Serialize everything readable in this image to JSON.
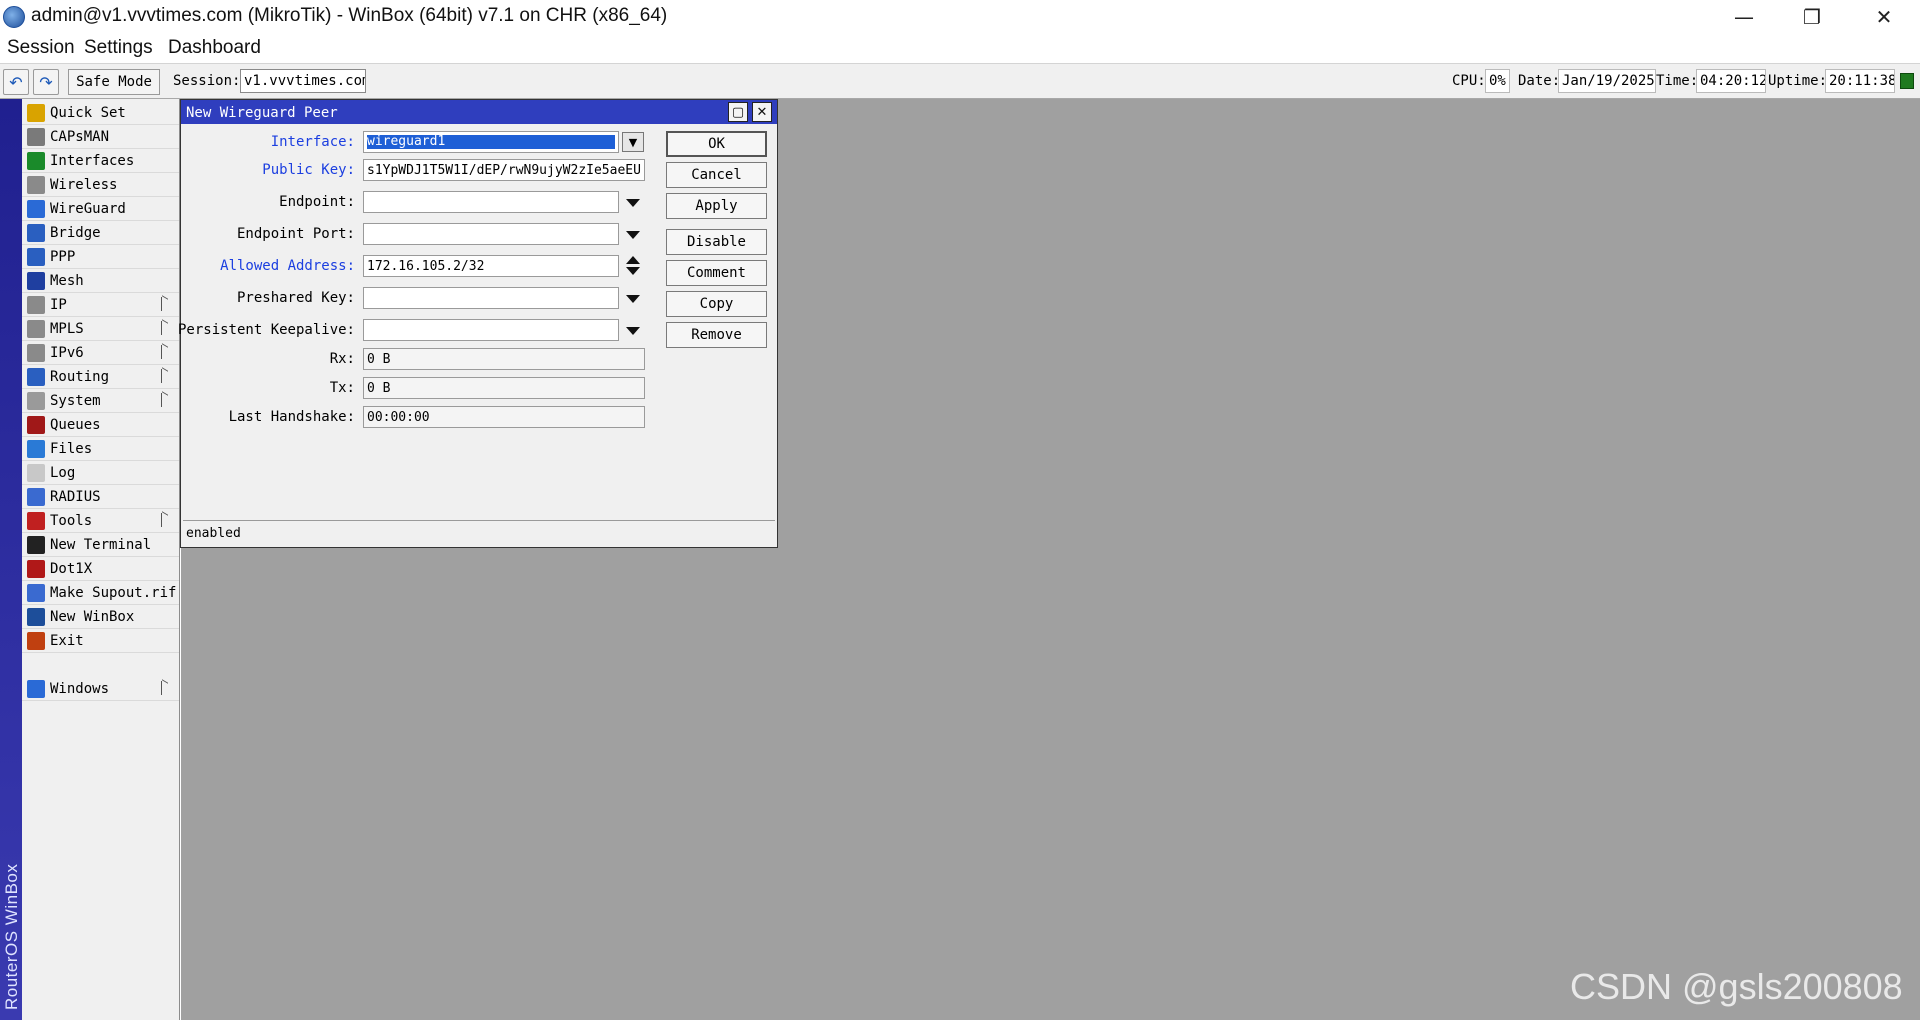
{
  "window": {
    "title": "admin@v1.vvvtimes.com (MikroTik) - WinBox (64bit) v7.1 on CHR (x86_64)",
    "controls": {
      "minimize": "—",
      "restore": "❐",
      "close": "✕"
    }
  },
  "menubar": [
    "Session",
    "Settings",
    "Dashboard"
  ],
  "toolbar": {
    "undo_icon": "↶",
    "redo_icon": "↷",
    "safe_mode": "Safe Mode",
    "session_label": "Session:",
    "session_value": "v1.vvvtimes.com",
    "cpu_label": "CPU:",
    "cpu_value": "0%",
    "date_label": "Date:",
    "date_value": "Jan/19/2025",
    "time_label": "Time:",
    "time_value": "04:20:12",
    "uptime_label": "Uptime:",
    "uptime_value": "20:11:38"
  },
  "brand": "RouterOS WinBox",
  "sidebar": {
    "items": [
      {
        "label": "Quick Set",
        "icon": "quick-set-icon",
        "color": "#d9a300",
        "submenu": false
      },
      {
        "label": "CAPsMAN",
        "icon": "capsman-icon",
        "color": "#7a7a7a",
        "submenu": false
      },
      {
        "label": "Interfaces",
        "icon": "interfaces-icon",
        "color": "#1a8a2a",
        "submenu": false
      },
      {
        "label": "Wireless",
        "icon": "wireless-icon",
        "color": "#8a8a8a",
        "submenu": false
      },
      {
        "label": "WireGuard",
        "icon": "wireguard-icon",
        "color": "#2a6ad6",
        "submenu": false
      },
      {
        "label": "Bridge",
        "icon": "bridge-icon",
        "color": "#2a5fc0",
        "submenu": false
      },
      {
        "label": "PPP",
        "icon": "ppp-icon",
        "color": "#2a5fc0",
        "submenu": false
      },
      {
        "label": "Mesh",
        "icon": "mesh-icon",
        "color": "#1f3fa0",
        "submenu": false
      },
      {
        "label": "IP",
        "icon": "ip-icon",
        "color": "#8a8a8a",
        "submenu": true
      },
      {
        "label": "MPLS",
        "icon": "mpls-icon",
        "color": "#8a8a8a",
        "submenu": true
      },
      {
        "label": "IPv6",
        "icon": "ipv6-icon",
        "color": "#8a8a8a",
        "submenu": true
      },
      {
        "label": "Routing",
        "icon": "routing-icon",
        "color": "#2a5fc0",
        "submenu": true
      },
      {
        "label": "System",
        "icon": "system-icon",
        "color": "#9a9a9a",
        "submenu": true
      },
      {
        "label": "Queues",
        "icon": "queues-icon",
        "color": "#a01818",
        "submenu": false
      },
      {
        "label": "Files",
        "icon": "files-icon",
        "color": "#2a7ad6",
        "submenu": false
      },
      {
        "label": "Log",
        "icon": "log-icon",
        "color": "#c8c8c8",
        "submenu": false
      },
      {
        "label": "RADIUS",
        "icon": "radius-icon",
        "color": "#3a6ad0",
        "submenu": false
      },
      {
        "label": "Tools",
        "icon": "tools-icon",
        "color": "#c02020",
        "submenu": true
      },
      {
        "label": "New Terminal",
        "icon": "terminal-icon",
        "color": "#222222",
        "submenu": false
      },
      {
        "label": "Dot1X",
        "icon": "dot1x-icon",
        "color": "#b01818",
        "submenu": false
      },
      {
        "label": "Make Supout.rif",
        "icon": "supout-icon",
        "color": "#3a6ad0",
        "submenu": false
      },
      {
        "label": "New WinBox",
        "icon": "winbox-icon",
        "color": "#1d4e9a",
        "submenu": false
      },
      {
        "label": "Exit",
        "icon": "exit-icon",
        "color": "#c04010",
        "submenu": false
      }
    ],
    "windows_item": {
      "label": "Windows",
      "icon": "windows-icon",
      "color": "#2a6ad6",
      "submenu": true
    }
  },
  "dialog": {
    "title": "New Wireguard Peer",
    "title_buttons": {
      "maximize": "▢",
      "close": "✕"
    },
    "fields": {
      "interface": {
        "label": "Interface:",
        "value": "wireguard1"
      },
      "public_key": {
        "label": "Public Key:",
        "value": "s1YpWDJ1T5W1I/dEP/rwN9ujyW2zIe5aeEU"
      },
      "endpoint": {
        "label": "Endpoint:",
        "value": ""
      },
      "endpoint_port": {
        "label": "Endpoint Port:",
        "value": ""
      },
      "allowed_address": {
        "label": "Allowed Address:",
        "value": "172.16.105.2/32"
      },
      "preshared_key": {
        "label": "Preshared Key:",
        "value": ""
      },
      "persistent_keepalive": {
        "label": "Persistent Keepalive:",
        "value": ""
      },
      "rx": {
        "label": "Rx:",
        "value": "0 B"
      },
      "tx": {
        "label": "Tx:",
        "value": "0 B"
      },
      "last_handshake": {
        "label": "Last Handshake:",
        "value": "00:00:00"
      }
    },
    "buttons": {
      "ok": "OK",
      "cancel": "Cancel",
      "apply": "Apply",
      "disable": "Disable",
      "comment": "Comment",
      "copy": "Copy",
      "remove": "Remove"
    },
    "status": "enabled"
  },
  "watermark": "CSDN @gsls200808",
  "colors": {
    "dialog_title_bg": "#2f3ebe",
    "required_label": "#1c3fe0",
    "selection": "#1e5fd6",
    "desktop": "#a0a0a0",
    "brand_strip": "#2a2aa0",
    "status_led": "#1f7a1f"
  }
}
